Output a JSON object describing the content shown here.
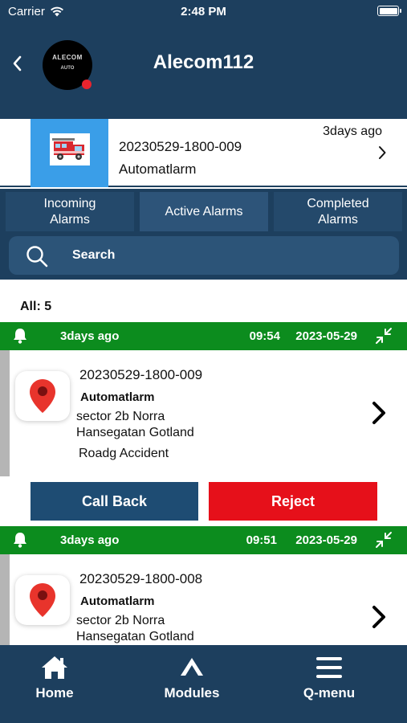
{
  "status_bar": {
    "carrier": "Carrier",
    "time": "2:48 PM"
  },
  "header": {
    "title": "Alecom112",
    "logo_line1": "ALECOM",
    "logo_line2": "AUTO"
  },
  "latest_alarm": {
    "number": "20230529-1800-009",
    "type": "Automatlarm",
    "ago": "3days ago"
  },
  "tabs": [
    {
      "label": "Incoming\nAlarms"
    },
    {
      "label": "Active Alarms"
    },
    {
      "label": "Completed\nAlarms"
    }
  ],
  "search": {
    "placeholder": "Search"
  },
  "summary": {
    "count_label": "All: 5"
  },
  "alarms": [
    {
      "ago": "3days ago",
      "time": "09:54",
      "date": "2023-05-29",
      "number": "20230529-1800-009",
      "type": "Automatlarm",
      "address_line1": "sector 2b Norra",
      "address_line2": "Hansegatan  Gotland",
      "description": "Roadg Accident",
      "callback_label": "Call Back",
      "reject_label": "Reject"
    },
    {
      "ago": "3days ago",
      "time": "09:51",
      "date": "2023-05-29",
      "number": "20230529-1800-008",
      "type": "Automatlarm",
      "address_line1": "sector 2b Norra",
      "address_line2": "Hansegatan  Gotland"
    }
  ],
  "bottom_nav": [
    {
      "label": "Home",
      "icon": "home-icon"
    },
    {
      "label": "Modules",
      "icon": "modules-icon"
    },
    {
      "label": "Q-menu",
      "icon": "menu-icon"
    }
  ],
  "colors": {
    "navy": "#1d3f5e",
    "green": "#0c8c1e",
    "reject": "#e6101a",
    "callback": "#1e4c73",
    "thumb": "#3a9ee8"
  }
}
